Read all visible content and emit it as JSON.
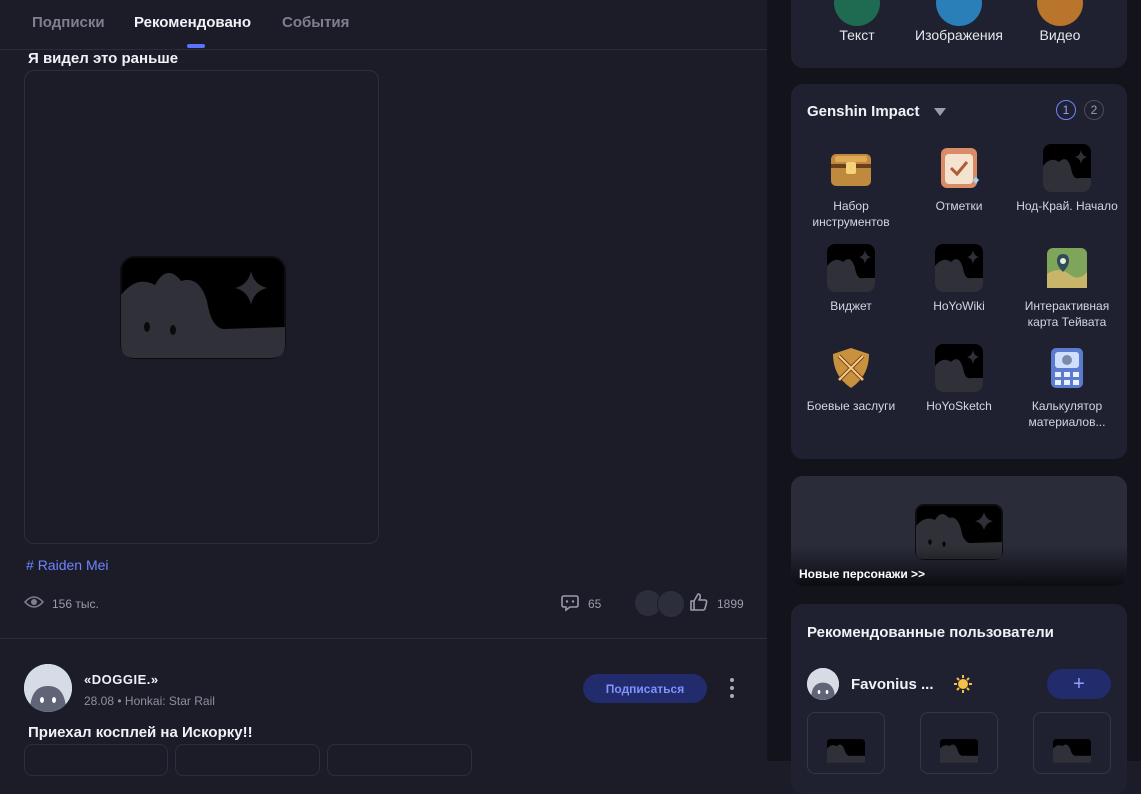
{
  "tabs": [
    {
      "label": "Подписки"
    },
    {
      "label": "Рекомендовано"
    },
    {
      "label": "События"
    }
  ],
  "post1": {
    "title": "Я видел это раньше",
    "hashtag": "Raiden Mei",
    "views": "156 тыс.",
    "comments": "65",
    "likes": "1899"
  },
  "post2": {
    "author": "«DOGGIE.»",
    "meta": "28.08 • Honkai: Star Rail",
    "subscribe_label": "Подписаться",
    "title": "Приехал косплей на Искорку!!"
  },
  "create": {
    "items": [
      {
        "label": "Текст",
        "color": "#1e6b52"
      },
      {
        "label": "Изображения",
        "color": "#2a7fb8"
      },
      {
        "label": "Видео",
        "color": "#b9752c"
      }
    ]
  },
  "game_panel": {
    "title": "Genshin Impact",
    "pages": [
      "1",
      "2"
    ],
    "tools": [
      {
        "label": "Набор инструментов",
        "icon": "toolbox-chest-icon"
      },
      {
        "label": "Отметки",
        "icon": "checkin-icon"
      },
      {
        "label": "Нод-Край. Начало",
        "icon": "image-placeholder-icon"
      },
      {
        "label": "Виджет",
        "icon": "image-placeholder-icon"
      },
      {
        "label": "HoYoWiki",
        "icon": "image-placeholder-icon"
      },
      {
        "label": "Интерактивная карта Тейвата",
        "icon": "map-icon"
      },
      {
        "label": "Боевые заслуги",
        "icon": "swords-shield-icon"
      },
      {
        "label": "HoYoSketch",
        "icon": "image-placeholder-icon"
      },
      {
        "label": "Калькулятор материалов...",
        "icon": "calculator-icon"
      }
    ]
  },
  "banner": {
    "label": "Новые персонажи >>"
  },
  "recommended": {
    "title": "Рекомендованные пользователи",
    "user_name": "Favonius ...",
    "follow_label": "+"
  },
  "colors": {
    "accent": "#5d72ff",
    "background": "#1b1c27",
    "panel": "#1f2130"
  }
}
